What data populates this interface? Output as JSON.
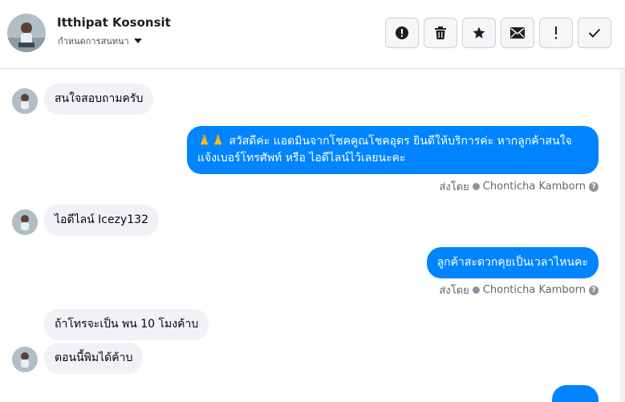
{
  "header": {
    "name": "Itthipat Kosonsit",
    "subtitle": "กำหนดการสนทนา",
    "actions": [
      {
        "icon": "alert-circle-icon",
        "name": "mark-spam-button"
      },
      {
        "icon": "trash-icon",
        "name": "delete-button"
      },
      {
        "icon": "star-icon",
        "name": "star-button"
      },
      {
        "icon": "envelope-icon",
        "name": "mark-unread-button"
      },
      {
        "icon": "exclamation-icon",
        "name": "follow-up-button"
      },
      {
        "icon": "check-icon",
        "name": "mark-done-button"
      }
    ]
  },
  "messages": {
    "m1": "สนใจสอบถามครับ",
    "m2": "🙏🙏 สวัสดีค่ะ แอดมินจากโชคคูณโชคอุดร ยินดีให้บริการค่ะ หากลูกค้าสนใจ แจ้งเบอร์โทรศัพท์ หรือ ไอดีไลน์ไว้เลยนะคะ",
    "m3": "ไอดีไลน์ Icezy132",
    "m4": "ลูกค้าสะดวกคุยเป็นเวลาไหนคะ",
    "m5": "ถ้าโทรจะเป็น พน 10 โมงค้าบ",
    "m6": "ตอนนี้พิมได้ค้าบ"
  },
  "sent_by": {
    "label": "ส่งโดย",
    "agent": "Chonticha Kamborn",
    "help": "?"
  },
  "colors": {
    "outgoing": "#0084ff",
    "incoming": "#f0f2f5"
  }
}
